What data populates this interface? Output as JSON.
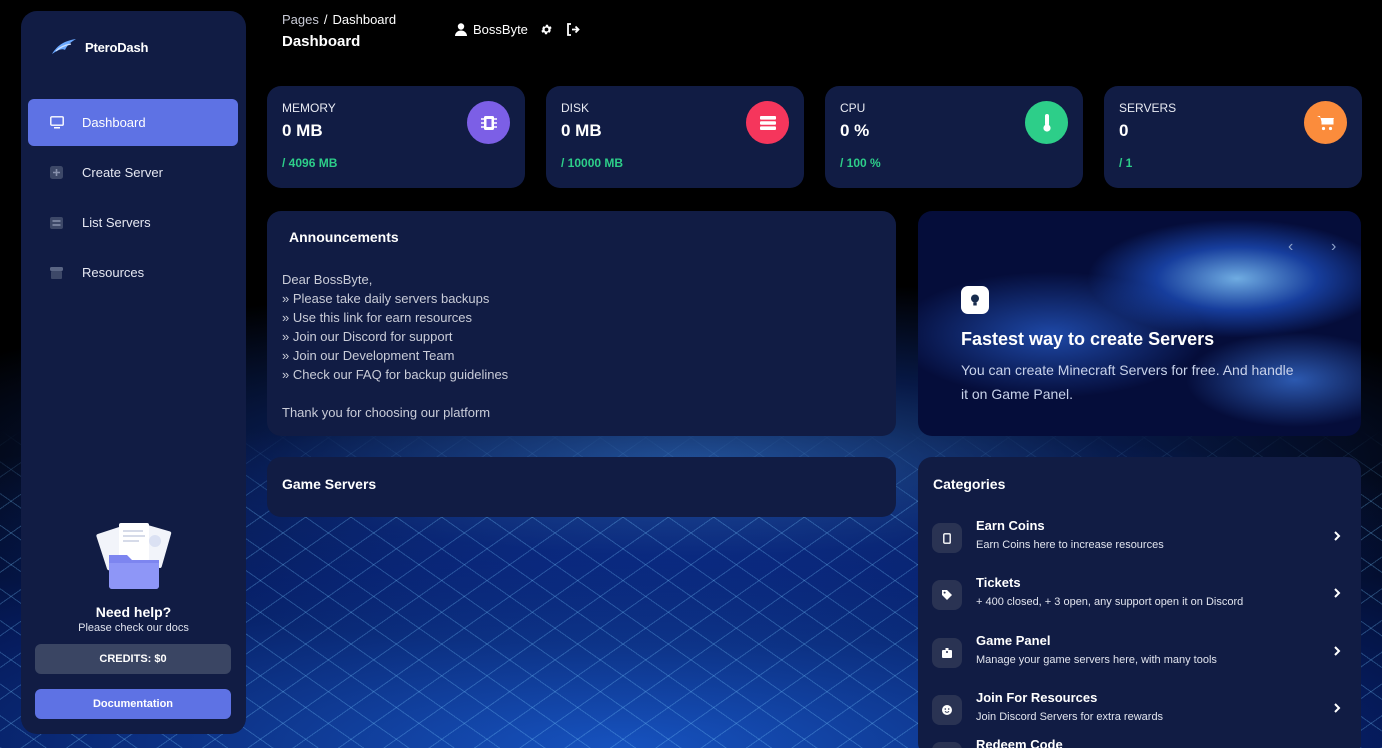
{
  "sidebar": {
    "brand": "PteroDash",
    "items": [
      {
        "label": "Dashboard",
        "icon": "monitor-icon"
      },
      {
        "label": "Create Server",
        "icon": "plus-square-icon"
      },
      {
        "label": "List Servers",
        "icon": "list-icon"
      },
      {
        "label": "Resources",
        "icon": "store-icon"
      }
    ],
    "help_title": "Need help?",
    "help_subtitle": "Please check our docs",
    "credits_label": "CREDITS: $0",
    "docs_label": "Documentation"
  },
  "header": {
    "breadcrumb_root": "Pages",
    "breadcrumb_current": "Dashboard",
    "title": "Dashboard",
    "username": "BossByte"
  },
  "stats": [
    {
      "label": "MEMORY",
      "value": "0 MB",
      "sub": "/ 4096 MB",
      "icon": "memory-chip-icon",
      "color": "#7c5fe6"
    },
    {
      "label": "DISK",
      "value": "0 MB",
      "sub": "/ 10000 MB",
      "icon": "database-icon",
      "color": "#f5365c"
    },
    {
      "label": "CPU",
      "value": "0 %",
      "sub": "/ 100 %",
      "icon": "thermometer-icon",
      "color": "#2dce89"
    },
    {
      "label": "SERVERS",
      "value": "0",
      "sub": "/ 1",
      "icon": "cart-icon",
      "color": "#fb8c3c"
    }
  ],
  "announcements": {
    "title": "Announcements",
    "lines": [
      "Dear BossByte,",
      "» Please take daily servers backups",
      "» Use this link for earn resources",
      "» Join our Discord for support",
      "» Join our Development Team",
      "» Check our FAQ for backup guidelines",
      "",
      "Thank you for choosing our platform"
    ]
  },
  "hero": {
    "title": "Fastest way to create Servers",
    "text": "You can create Minecraft Servers for free. And handle it on Game Panel.",
    "prev": "‹",
    "next": "›"
  },
  "game_servers": {
    "title": "Game Servers"
  },
  "categories": {
    "title": "Categories",
    "items": [
      {
        "title": "Earn Coins",
        "desc": "Earn Coins here to increase resources",
        "icon": "phone-icon"
      },
      {
        "title": "Tickets",
        "desc": "+ 400 closed, + 3 open, any support open it on Discord",
        "icon": "tag-icon"
      },
      {
        "title": "Game Panel",
        "desc": "Manage your game servers here, with many tools",
        "icon": "box-icon"
      },
      {
        "title": "Join For Resources",
        "desc": "Join Discord Servers for extra rewards",
        "icon": "smile-icon"
      },
      {
        "title": "Redeem Code",
        "desc": "",
        "icon": "gift-icon"
      }
    ]
  },
  "colors": {
    "accent": "#5e72e4",
    "card_bg": "#111c44",
    "success": "#2dce89"
  }
}
